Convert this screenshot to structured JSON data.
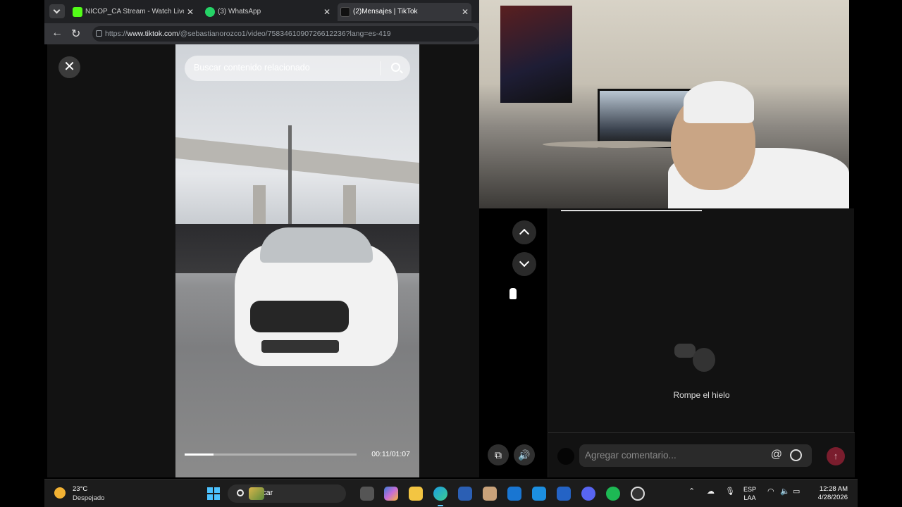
{
  "browser": {
    "tabs": [
      {
        "title": "NICOP_CA Stream - Watch Live on",
        "favicon_color": "#53fc18"
      },
      {
        "title": "(3) WhatsApp",
        "favicon_color": "#25d366"
      },
      {
        "title": "(2)Mensajes | TikTok",
        "favicon_color": "#ffffff"
      }
    ],
    "url_prefix": "https://",
    "url_host": "www.tiktok.com",
    "url_path": "/@sebastianorozco1/video/7583461090726612236?lang=es-419"
  },
  "video": {
    "search_placeholder": "Buscar contenido relacionado",
    "timecode": "00:11/01:07",
    "progress": 0.17
  },
  "comments": {
    "empty_text": "Rompe el hielo",
    "input_placeholder": "Agregar comentario..."
  },
  "taskbar": {
    "temperature": "23°C",
    "condition": "Despejado",
    "search_label": "Buscar",
    "language_line1": "ESP",
    "language_line2": "LAA",
    "time": "12:28 AM",
    "date": "4/28/2026"
  },
  "colors": {
    "accent": "#fe2c55",
    "send_disabled": "#7a1d2d",
    "taskbar_bg": "#1c1c1c"
  }
}
